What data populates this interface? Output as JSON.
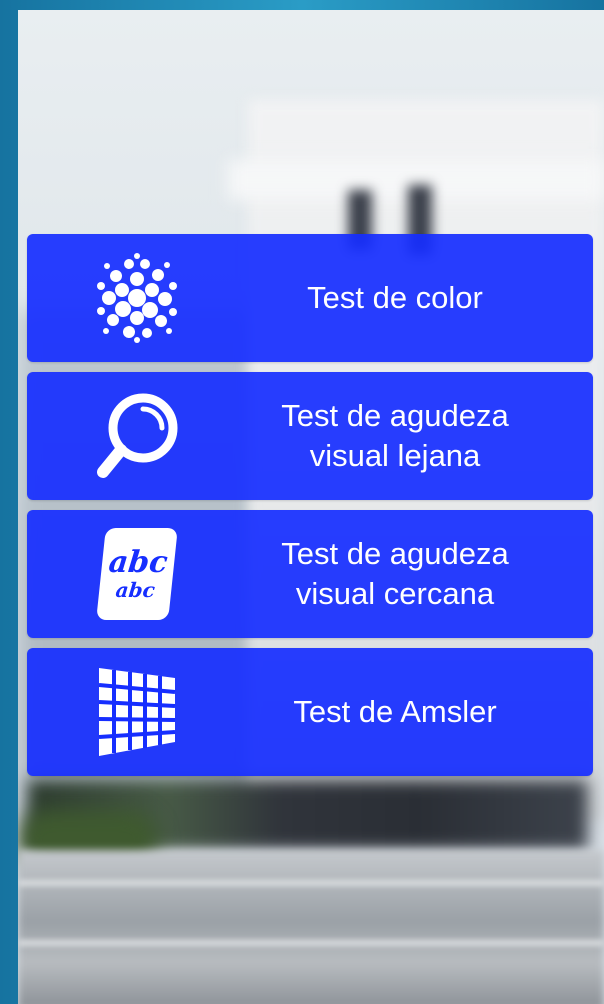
{
  "menu": {
    "items": [
      {
        "label": "Test de color",
        "icon": "dots-circle-icon"
      },
      {
        "label": "Test de agudeza\nvisual lejana",
        "icon": "magnifier-icon"
      },
      {
        "label": "Test de agudeza\nvisual cercana",
        "icon": "abc-card-icon"
      },
      {
        "label": "Test de Amsler",
        "icon": "amsler-grid-icon"
      }
    ],
    "abc_card": {
      "big": "abc",
      "small": "abc"
    }
  },
  "colors": {
    "button_bg": "#162eff",
    "frame": "#1e8cb8",
    "text": "#ffffff"
  }
}
